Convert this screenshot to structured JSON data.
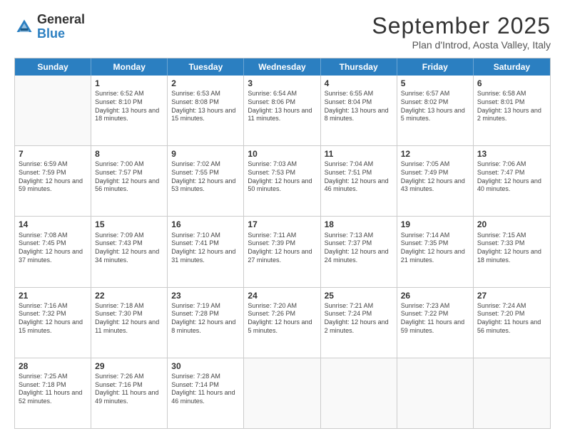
{
  "header": {
    "logo_general": "General",
    "logo_blue": "Blue",
    "month_title": "September 2025",
    "location": "Plan d'Introd, Aosta Valley, Italy"
  },
  "weekdays": [
    "Sunday",
    "Monday",
    "Tuesday",
    "Wednesday",
    "Thursday",
    "Friday",
    "Saturday"
  ],
  "weeks": [
    [
      {
        "day": "",
        "empty": true
      },
      {
        "day": "1",
        "sunrise": "Sunrise: 6:52 AM",
        "sunset": "Sunset: 8:10 PM",
        "daylight": "Daylight: 13 hours and 18 minutes."
      },
      {
        "day": "2",
        "sunrise": "Sunrise: 6:53 AM",
        "sunset": "Sunset: 8:08 PM",
        "daylight": "Daylight: 13 hours and 15 minutes."
      },
      {
        "day": "3",
        "sunrise": "Sunrise: 6:54 AM",
        "sunset": "Sunset: 8:06 PM",
        "daylight": "Daylight: 13 hours and 11 minutes."
      },
      {
        "day": "4",
        "sunrise": "Sunrise: 6:55 AM",
        "sunset": "Sunset: 8:04 PM",
        "daylight": "Daylight: 13 hours and 8 minutes."
      },
      {
        "day": "5",
        "sunrise": "Sunrise: 6:57 AM",
        "sunset": "Sunset: 8:02 PM",
        "daylight": "Daylight: 13 hours and 5 minutes."
      },
      {
        "day": "6",
        "sunrise": "Sunrise: 6:58 AM",
        "sunset": "Sunset: 8:01 PM",
        "daylight": "Daylight: 13 hours and 2 minutes."
      }
    ],
    [
      {
        "day": "7",
        "sunrise": "Sunrise: 6:59 AM",
        "sunset": "Sunset: 7:59 PM",
        "daylight": "Daylight: 12 hours and 59 minutes."
      },
      {
        "day": "8",
        "sunrise": "Sunrise: 7:00 AM",
        "sunset": "Sunset: 7:57 PM",
        "daylight": "Daylight: 12 hours and 56 minutes."
      },
      {
        "day": "9",
        "sunrise": "Sunrise: 7:02 AM",
        "sunset": "Sunset: 7:55 PM",
        "daylight": "Daylight: 12 hours and 53 minutes."
      },
      {
        "day": "10",
        "sunrise": "Sunrise: 7:03 AM",
        "sunset": "Sunset: 7:53 PM",
        "daylight": "Daylight: 12 hours and 50 minutes."
      },
      {
        "day": "11",
        "sunrise": "Sunrise: 7:04 AM",
        "sunset": "Sunset: 7:51 PM",
        "daylight": "Daylight: 12 hours and 46 minutes."
      },
      {
        "day": "12",
        "sunrise": "Sunrise: 7:05 AM",
        "sunset": "Sunset: 7:49 PM",
        "daylight": "Daylight: 12 hours and 43 minutes."
      },
      {
        "day": "13",
        "sunrise": "Sunrise: 7:06 AM",
        "sunset": "Sunset: 7:47 PM",
        "daylight": "Daylight: 12 hours and 40 minutes."
      }
    ],
    [
      {
        "day": "14",
        "sunrise": "Sunrise: 7:08 AM",
        "sunset": "Sunset: 7:45 PM",
        "daylight": "Daylight: 12 hours and 37 minutes."
      },
      {
        "day": "15",
        "sunrise": "Sunrise: 7:09 AM",
        "sunset": "Sunset: 7:43 PM",
        "daylight": "Daylight: 12 hours and 34 minutes."
      },
      {
        "day": "16",
        "sunrise": "Sunrise: 7:10 AM",
        "sunset": "Sunset: 7:41 PM",
        "daylight": "Daylight: 12 hours and 31 minutes."
      },
      {
        "day": "17",
        "sunrise": "Sunrise: 7:11 AM",
        "sunset": "Sunset: 7:39 PM",
        "daylight": "Daylight: 12 hours and 27 minutes."
      },
      {
        "day": "18",
        "sunrise": "Sunrise: 7:13 AM",
        "sunset": "Sunset: 7:37 PM",
        "daylight": "Daylight: 12 hours and 24 minutes."
      },
      {
        "day": "19",
        "sunrise": "Sunrise: 7:14 AM",
        "sunset": "Sunset: 7:35 PM",
        "daylight": "Daylight: 12 hours and 21 minutes."
      },
      {
        "day": "20",
        "sunrise": "Sunrise: 7:15 AM",
        "sunset": "Sunset: 7:33 PM",
        "daylight": "Daylight: 12 hours and 18 minutes."
      }
    ],
    [
      {
        "day": "21",
        "sunrise": "Sunrise: 7:16 AM",
        "sunset": "Sunset: 7:32 PM",
        "daylight": "Daylight: 12 hours and 15 minutes."
      },
      {
        "day": "22",
        "sunrise": "Sunrise: 7:18 AM",
        "sunset": "Sunset: 7:30 PM",
        "daylight": "Daylight: 12 hours and 11 minutes."
      },
      {
        "day": "23",
        "sunrise": "Sunrise: 7:19 AM",
        "sunset": "Sunset: 7:28 PM",
        "daylight": "Daylight: 12 hours and 8 minutes."
      },
      {
        "day": "24",
        "sunrise": "Sunrise: 7:20 AM",
        "sunset": "Sunset: 7:26 PM",
        "daylight": "Daylight: 12 hours and 5 minutes."
      },
      {
        "day": "25",
        "sunrise": "Sunrise: 7:21 AM",
        "sunset": "Sunset: 7:24 PM",
        "daylight": "Daylight: 12 hours and 2 minutes."
      },
      {
        "day": "26",
        "sunrise": "Sunrise: 7:23 AM",
        "sunset": "Sunset: 7:22 PM",
        "daylight": "Daylight: 11 hours and 59 minutes."
      },
      {
        "day": "27",
        "sunrise": "Sunrise: 7:24 AM",
        "sunset": "Sunset: 7:20 PM",
        "daylight": "Daylight: 11 hours and 56 minutes."
      }
    ],
    [
      {
        "day": "28",
        "sunrise": "Sunrise: 7:25 AM",
        "sunset": "Sunset: 7:18 PM",
        "daylight": "Daylight: 11 hours and 52 minutes."
      },
      {
        "day": "29",
        "sunrise": "Sunrise: 7:26 AM",
        "sunset": "Sunset: 7:16 PM",
        "daylight": "Daylight: 11 hours and 49 minutes."
      },
      {
        "day": "30",
        "sunrise": "Sunrise: 7:28 AM",
        "sunset": "Sunset: 7:14 PM",
        "daylight": "Daylight: 11 hours and 46 minutes."
      },
      {
        "day": "",
        "empty": true
      },
      {
        "day": "",
        "empty": true
      },
      {
        "day": "",
        "empty": true
      },
      {
        "day": "",
        "empty": true
      }
    ]
  ]
}
